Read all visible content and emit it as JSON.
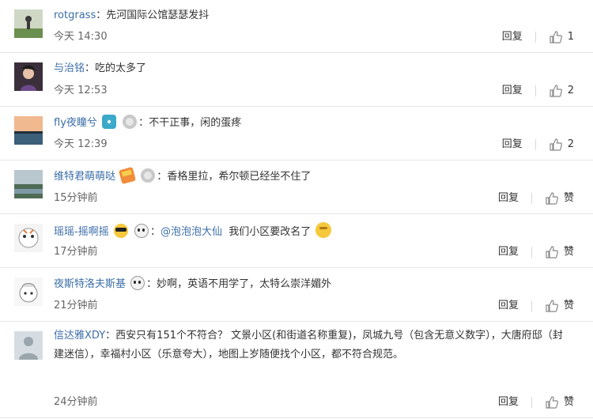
{
  "reply_label": "回复",
  "comments": [
    {
      "user": "rotgrass",
      "colon": "：",
      "text": "先河国际公馆瑟瑟发抖",
      "time": "今天 14:30",
      "likes": "1"
    },
    {
      "user": "与治铭",
      "colon": "：",
      "text": "吃的太多了",
      "time": "今天 12:53",
      "likes": "2"
    },
    {
      "user": "fly夜瞳兮",
      "colon": "：",
      "text": "不干正事，闲的蛋疼",
      "time": "今天 12:39",
      "likes": "2"
    },
    {
      "user": "维特君萌萌哒",
      "colon": "：",
      "text": "香格里拉，希尔顿已经坐不住了",
      "time": "15分钟前",
      "likes": "赞"
    },
    {
      "user": "瑶瑶-摇啊摇",
      "colon": "：",
      "mention": "@泡泡泡大仙",
      "text": "我们小区要改名了",
      "time": "17分钟前",
      "likes": "赞"
    },
    {
      "user": "夜斯特洛夫斯基",
      "colon": "：",
      "text": "妙啊，英语不用学了，太特么崇洋媚外",
      "time": "21分钟前",
      "likes": "赞"
    },
    {
      "user": "信达雅XDY",
      "colon": "：",
      "text": "西安只有151个不符合？ 文景小区(和街道名称重复)，凤城九号（包含无意义数字），大唐府邸（封建迷信），幸福村小区（乐意夸大），地图上岁随便找个小区，都不符合规范。",
      "time": "24分钟前",
      "likes": "赞"
    }
  ],
  "icons": {
    "like": "thumbs-up-icon",
    "camera_badge": "camera-badge-icon",
    "medal_badge": "medal-badge-icon",
    "flag_emoji": "flag-emoji-icon",
    "sunglasses_emoji": "sunglasses-emoji-icon",
    "panda_emoji": "panda-emoji-icon",
    "thinking_emoji": "thinking-emoji-icon"
  },
  "colors": {
    "username": "#3b6ea8",
    "text": "#333333",
    "time": "#666666",
    "divider": "#e6e6e6"
  }
}
